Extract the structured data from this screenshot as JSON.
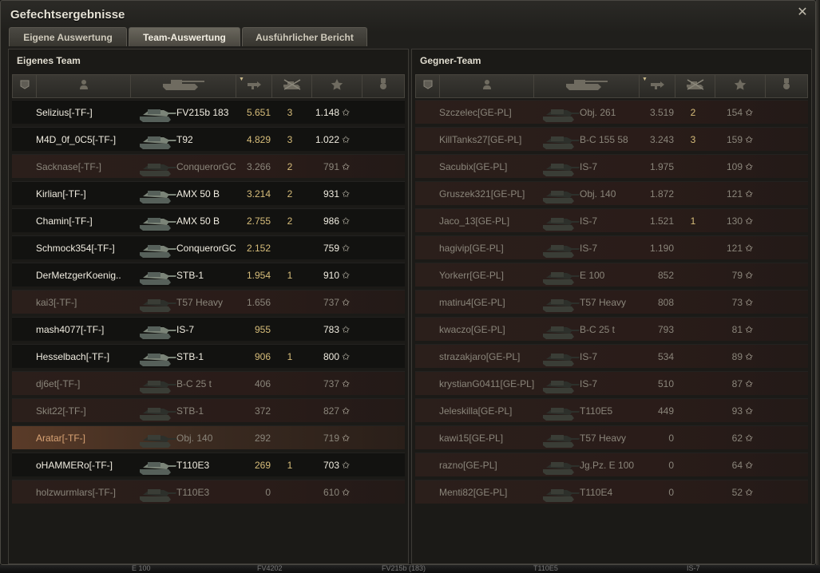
{
  "window": {
    "title": "Gefechtsergebnisse",
    "close_icon": "close-icon"
  },
  "tabs": [
    {
      "label": "Eigene Auswertung",
      "active": false
    },
    {
      "label": "Team-Auswertung",
      "active": true
    },
    {
      "label": "Ausführlicher Bericht",
      "active": false
    }
  ],
  "teams": {
    "own": {
      "title": "Eigenes Team",
      "players": [
        {
          "name": "Selizius[-TF-]",
          "tank": "FV215b 183",
          "damage": "5.651",
          "kills": "3",
          "xp": "1.148",
          "alive": true
        },
        {
          "name": "M4D_0f_0C5[-TF-]",
          "tank": "T92",
          "damage": "4.829",
          "kills": "3",
          "xp": "1.022",
          "alive": true
        },
        {
          "name": "Sacknase[-TF-]",
          "tank": "ConquerorGC",
          "damage": "3.266",
          "kills": "2",
          "xp": "791",
          "alive": false
        },
        {
          "name": "Kirlian[-TF-]",
          "tank": "AMX 50 B",
          "damage": "3.214",
          "kills": "2",
          "xp": "931",
          "alive": true
        },
        {
          "name": "Chamin[-TF-]",
          "tank": "AMX 50 B",
          "damage": "2.755",
          "kills": "2",
          "xp": "986",
          "alive": true
        },
        {
          "name": "Schmock354[-TF-]",
          "tank": "ConquerorGC",
          "damage": "2.152",
          "kills": "",
          "xp": "759",
          "alive": true
        },
        {
          "name": "DerMetzgerKoenig..",
          "tank": "STB-1",
          "damage": "1.954",
          "kills": "1",
          "xp": "910",
          "alive": true
        },
        {
          "name": "kai3[-TF-]",
          "tank": "T57 Heavy",
          "damage": "1.656",
          "kills": "",
          "xp": "737",
          "alive": false
        },
        {
          "name": "mash4077[-TF-]",
          "tank": "IS-7",
          "damage": "955",
          "kills": "",
          "xp": "783",
          "alive": true
        },
        {
          "name": "Hesselbach[-TF-]",
          "tank": "STB-1",
          "damage": "906",
          "kills": "1",
          "xp": "800",
          "alive": true
        },
        {
          "name": "dj6et[-TF-]",
          "tank": "B-C 25 t",
          "damage": "406",
          "kills": "",
          "xp": "737",
          "alive": false
        },
        {
          "name": "Skit22[-TF-]",
          "tank": "STB-1",
          "damage": "372",
          "kills": "",
          "xp": "827",
          "alive": false
        },
        {
          "name": "Aratar[-TF-]",
          "tank": "Obj. 140",
          "damage": "292",
          "kills": "",
          "xp": "719",
          "alive": false,
          "me": true
        },
        {
          "name": "oHAMMERo[-TF-]",
          "tank": "T110E3",
          "damage": "269",
          "kills": "1",
          "xp": "703",
          "alive": true
        },
        {
          "name": "holzwurmlars[-TF-]",
          "tank": "T110E3",
          "damage": "0",
          "kills": "",
          "xp": "610",
          "alive": false
        }
      ]
    },
    "enemy": {
      "title": "Gegner-Team",
      "players": [
        {
          "name": "Szczelec[GE-PL]",
          "tank": "Obj. 261",
          "damage": "3.519",
          "kills": "2",
          "xp": "154",
          "alive": false
        },
        {
          "name": "KillTanks27[GE-PL]",
          "tank": "B-C 155 58",
          "damage": "3.243",
          "kills": "3",
          "xp": "159",
          "alive": false
        },
        {
          "name": "Sacubix[GE-PL]",
          "tank": "IS-7",
          "damage": "1.975",
          "kills": "",
          "xp": "109",
          "alive": false
        },
        {
          "name": "Gruszek321[GE-PL]",
          "tank": "Obj. 140",
          "damage": "1.872",
          "kills": "",
          "xp": "121",
          "alive": false
        },
        {
          "name": "Jaco_13[GE-PL]",
          "tank": "IS-7",
          "damage": "1.521",
          "kills": "1",
          "xp": "130",
          "alive": false
        },
        {
          "name": "hagivip[GE-PL]",
          "tank": "IS-7",
          "damage": "1.190",
          "kills": "",
          "xp": "121",
          "alive": false
        },
        {
          "name": "Yorkerr[GE-PL]",
          "tank": "E 100",
          "damage": "852",
          "kills": "",
          "xp": "79",
          "alive": false
        },
        {
          "name": "matiru4[GE-PL]",
          "tank": "T57 Heavy",
          "damage": "808",
          "kills": "",
          "xp": "73",
          "alive": false
        },
        {
          "name": "kwaczo[GE-PL]",
          "tank": "B-C 25 t",
          "damage": "793",
          "kills": "",
          "xp": "81",
          "alive": false
        },
        {
          "name": "strazakjaro[GE-PL]",
          "tank": "IS-7",
          "damage": "534",
          "kills": "",
          "xp": "89",
          "alive": false
        },
        {
          "name": "krystianG0411[GE-PL]",
          "tank": "IS-7",
          "damage": "510",
          "kills": "",
          "xp": "87",
          "alive": false
        },
        {
          "name": "Jeleskilla[GE-PL]",
          "tank": "T110E5",
          "damage": "449",
          "kills": "",
          "xp": "93",
          "alive": false
        },
        {
          "name": "kawi15[GE-PL]",
          "tank": "T57 Heavy",
          "damage": "0",
          "kills": "",
          "xp": "62",
          "alive": false
        },
        {
          "name": "razno[GE-PL]",
          "tank": "Jg.Pz. E 100",
          "damage": "0",
          "kills": "",
          "xp": "64",
          "alive": false
        },
        {
          "name": "Menti82[GE-PL]",
          "tank": "T110E4",
          "damage": "0",
          "kills": "",
          "xp": "52",
          "alive": false
        }
      ]
    }
  },
  "columns": [
    "squad-icon",
    "player-icon",
    "tank-icon",
    "damage-icon",
    "kills-icon",
    "xp-star-icon",
    "medal-icon"
  ],
  "star_glyph": "✩",
  "background_strip": [
    "E 100",
    "FV4202",
    "FV215b (183)",
    "T110E5",
    "IS-7"
  ],
  "colors": {
    "damage": "#d7bd7a",
    "dead_row": "#2b1f1b",
    "me_row": "#5a3b28"
  }
}
